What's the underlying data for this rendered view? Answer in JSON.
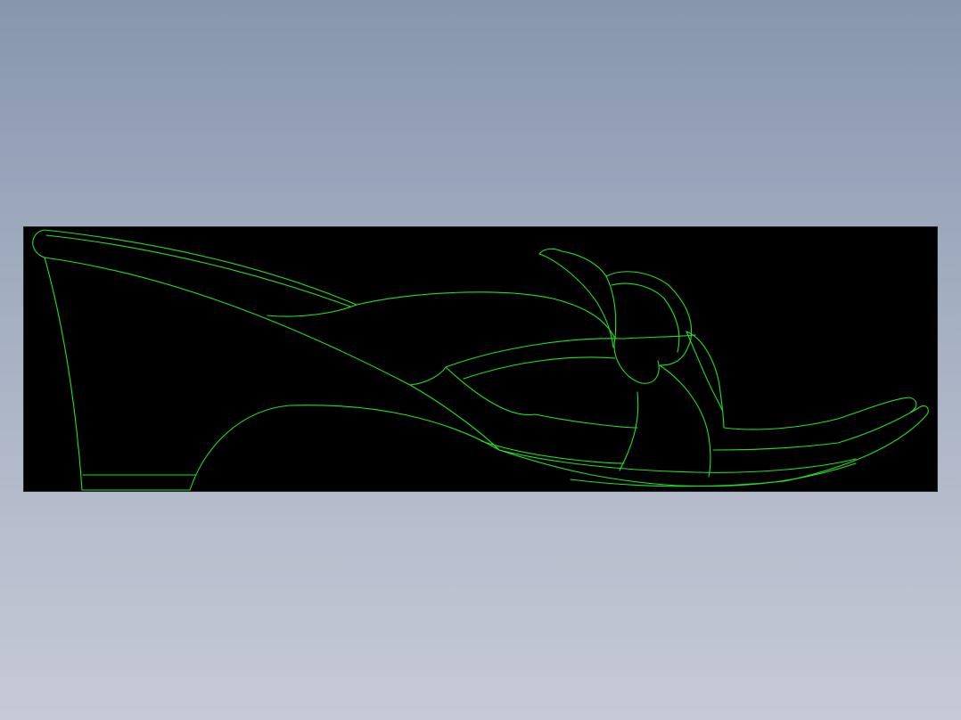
{
  "viewport": {
    "background_top": "#8796ad",
    "background_bottom": "#c6cad6"
  },
  "drawing": {
    "panel_color": "#000000",
    "line_color": "#22e022",
    "subject": "sandal-side-view"
  }
}
